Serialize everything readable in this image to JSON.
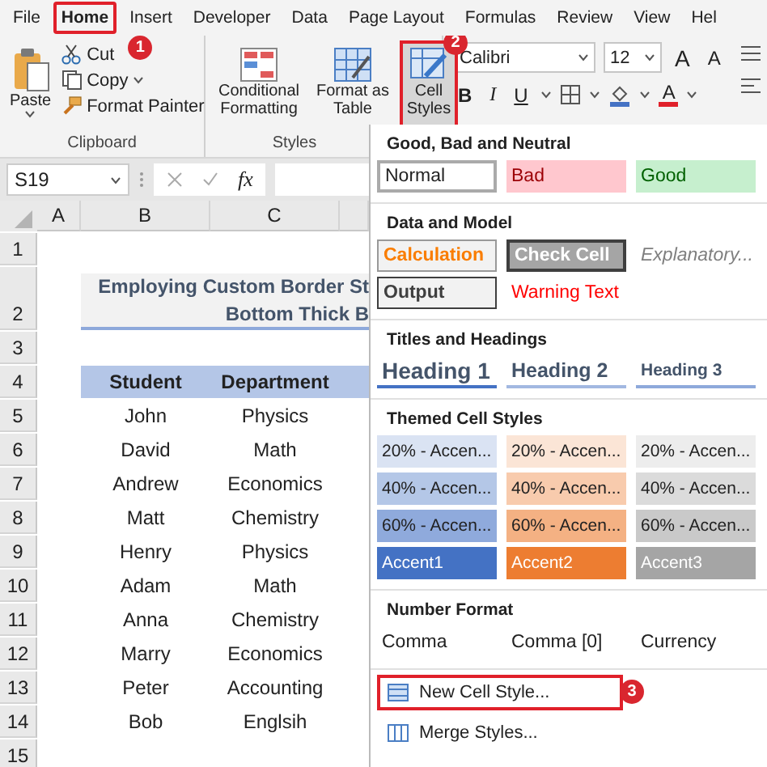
{
  "ribbon_tabs": [
    {
      "label": "File",
      "selected": false,
      "highlighted": false
    },
    {
      "label": "Home",
      "selected": true,
      "highlighted": true,
      "callout": "1"
    },
    {
      "label": "Insert",
      "selected": false,
      "highlighted": false
    },
    {
      "label": "Developer",
      "selected": false,
      "highlighted": false
    },
    {
      "label": "Data",
      "selected": false,
      "highlighted": false
    },
    {
      "label": "Page Layout",
      "selected": false,
      "highlighted": false
    },
    {
      "label": "Formulas",
      "selected": false,
      "highlighted": false
    },
    {
      "label": "Review",
      "selected": false,
      "highlighted": false
    },
    {
      "label": "View",
      "selected": false,
      "highlighted": false
    },
    {
      "label": "Hel",
      "selected": false,
      "highlighted": false
    }
  ],
  "clipboard": {
    "paste": "Paste",
    "commands": [
      {
        "label": "Cut",
        "kind": "cut",
        "dropdown": false
      },
      {
        "label": "Copy",
        "kind": "copy",
        "dropdown": true
      },
      {
        "label": "Format Painter",
        "kind": "painter",
        "dropdown": false
      }
    ],
    "label": "Clipboard"
  },
  "styles_group": {
    "buttons": [
      {
        "label": "Conditional Formatting",
        "kind": "conditional",
        "highlighted": false
      },
      {
        "label": "Format as Table",
        "kind": "table",
        "highlighted": false
      },
      {
        "label": "Cell Styles",
        "kind": "cell_styles",
        "highlighted": true,
        "callout": "2"
      }
    ],
    "label": "Styles"
  },
  "font": {
    "name": "Calibri",
    "size": "12",
    "grow": "A",
    "shrink": "A",
    "bold": "B",
    "italic": "I",
    "underline": "U",
    "color_letter": "A"
  },
  "formula_bar": {
    "name_box": "S19",
    "function": "fx"
  },
  "sheet": {
    "columns": [
      "A",
      "B",
      "C"
    ],
    "rows": [
      {
        "number": "1",
        "kind": "blank"
      },
      {
        "number": "2",
        "kind": "title",
        "lines": [
          "Employing Custom Border St",
          "Bottom Thick B"
        ]
      },
      {
        "number": "3",
        "kind": "blank"
      },
      {
        "number": "4",
        "kind": "header",
        "cells": [
          "Student",
          "Department"
        ]
      },
      {
        "number": "5",
        "kind": "data",
        "cells": [
          "John",
          "Physics"
        ]
      },
      {
        "number": "6",
        "kind": "data",
        "cells": [
          "David",
          "Math"
        ]
      },
      {
        "number": "7",
        "kind": "data",
        "cells": [
          "Andrew",
          "Economics"
        ]
      },
      {
        "number": "8",
        "kind": "data",
        "cells": [
          "Matt",
          "Chemistry"
        ]
      },
      {
        "number": "9",
        "kind": "data",
        "cells": [
          "Henry",
          "Physics"
        ]
      },
      {
        "number": "10",
        "kind": "data",
        "cells": [
          "Adam",
          "Math"
        ]
      },
      {
        "number": "11",
        "kind": "data",
        "cells": [
          "Anna",
          "Chemistry"
        ]
      },
      {
        "number": "12",
        "kind": "data",
        "cells": [
          "Marry",
          "Economics"
        ]
      },
      {
        "number": "13",
        "kind": "data",
        "cells": [
          "Peter",
          "Accounting"
        ]
      },
      {
        "number": "14",
        "kind": "data",
        "cells": [
          "Bob",
          "Englsih"
        ]
      },
      {
        "number": "15",
        "kind": "blank"
      }
    ]
  },
  "cell_styles_menu": {
    "sections": [
      {
        "title": "Good, Bad and Neutral",
        "styles": [
          {
            "label": "Normal",
            "kind": "normal"
          },
          {
            "label": "Bad",
            "kind": "bad"
          },
          {
            "label": "Good",
            "kind": "good"
          }
        ]
      },
      {
        "title": "Data and Model",
        "styles": [
          {
            "label": "Calculation",
            "kind": "calculation"
          },
          {
            "label": "Check Cell",
            "kind": "check"
          },
          {
            "label": "Explanatory...",
            "kind": "explanatory"
          },
          {
            "label": "Output",
            "kind": "output"
          },
          {
            "label": "Warning Text",
            "kind": "warning"
          }
        ]
      },
      {
        "title": "Titles and Headings",
        "styles": [
          {
            "label": "Heading 1",
            "kind": "heading1"
          },
          {
            "label": "Heading 2",
            "kind": "heading2"
          },
          {
            "label": "Heading 3",
            "kind": "heading3"
          }
        ]
      },
      {
        "title": "Themed Cell Styles",
        "styles": [
          {
            "label": "20% - Accen...",
            "kind": "themed",
            "color": "#dae3f3"
          },
          {
            "label": "20% - Accen...",
            "kind": "themed",
            "color": "#fbe5d6"
          },
          {
            "label": "20% - Accen...",
            "kind": "themed",
            "color": "#ededed"
          },
          {
            "label": "40% - Accen...",
            "kind": "themed",
            "color": "#b4c7e7"
          },
          {
            "label": "40% - Accen...",
            "kind": "themed",
            "color": "#f8cbad"
          },
          {
            "label": "40% - Accen...",
            "kind": "themed",
            "color": "#dbdbdb"
          },
          {
            "label": "60% - Accen...",
            "kind": "themed",
            "color": "#8faadc"
          },
          {
            "label": "60% - Accen...",
            "kind": "themed",
            "color": "#f4b183"
          },
          {
            "label": "60% - Accen...",
            "kind": "themed",
            "color": "#c9c9c9"
          },
          {
            "label": "Accent1",
            "kind": "accent",
            "color": "#4472c4"
          },
          {
            "label": "Accent2",
            "kind": "accent",
            "color": "#ed7d31"
          },
          {
            "label": "Accent3",
            "kind": "accent",
            "color": "#a5a5a5"
          }
        ]
      },
      {
        "title": "Number Format",
        "styles": [
          {
            "label": "Comma",
            "kind": "plain"
          },
          {
            "label": "Comma [0]",
            "kind": "plain"
          },
          {
            "label": "Currency",
            "kind": "plain"
          }
        ]
      }
    ],
    "commands": [
      {
        "label": "New Cell Style...",
        "highlighted": true,
        "callout": "3"
      },
      {
        "label": "Merge Styles...",
        "highlighted": false
      }
    ]
  }
}
